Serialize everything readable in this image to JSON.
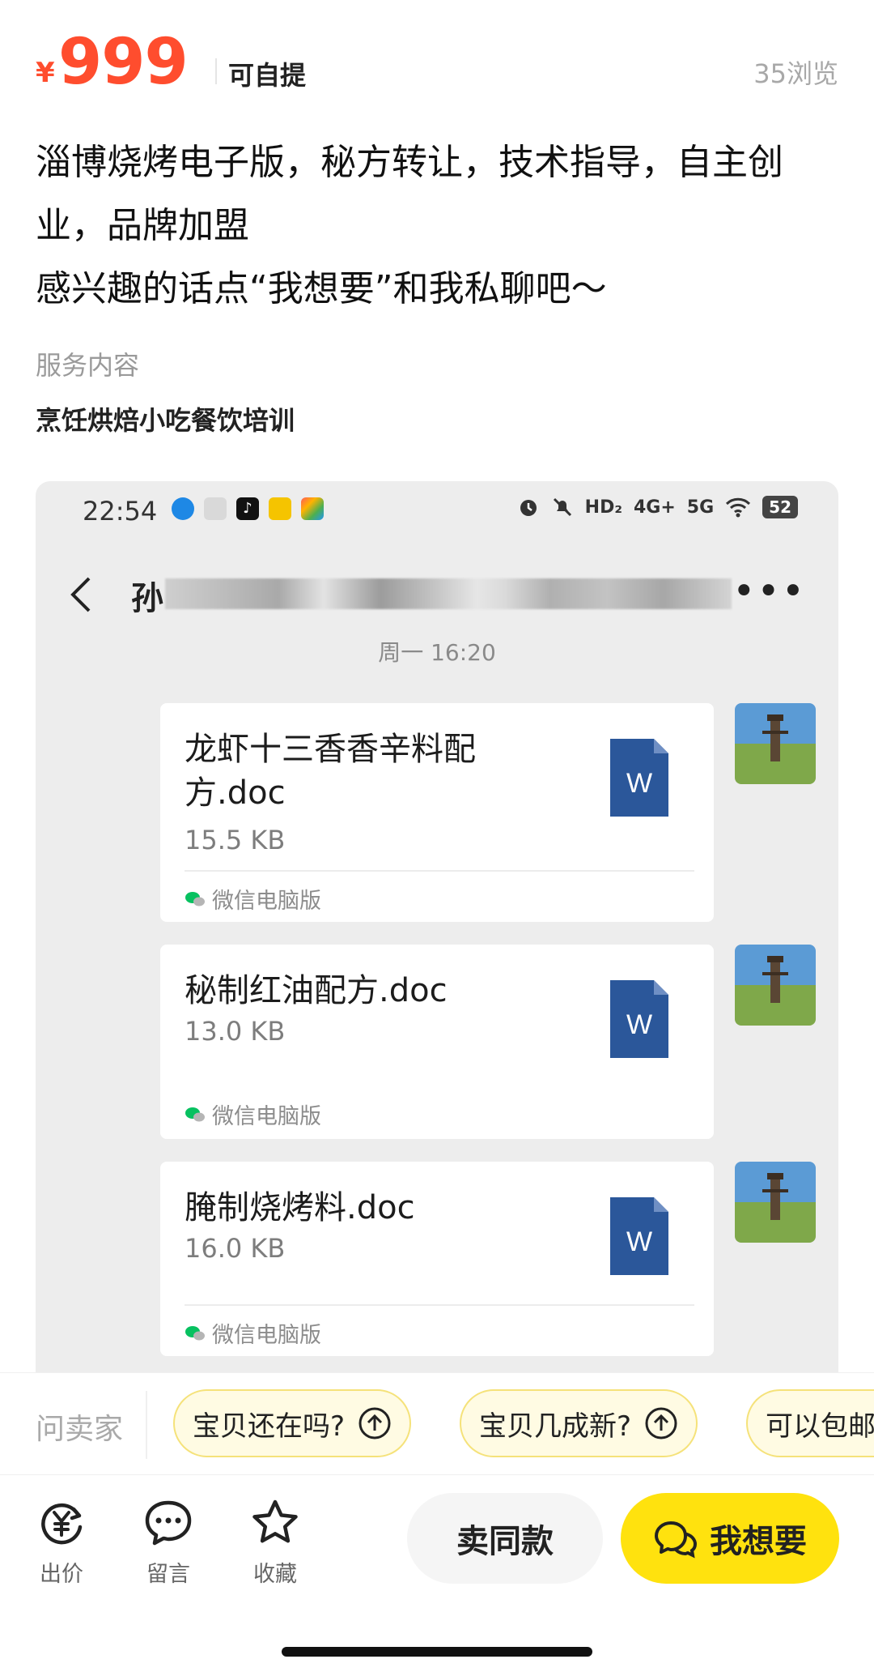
{
  "price": {
    "currency": "¥",
    "amount": "999",
    "pickup": "可自提",
    "views": "35浏览"
  },
  "description": {
    "lines": [
      "淄博烧烤电子版，秘方转让，技术指导，自主创",
      "业，品牌加盟",
      "感兴趣的话点“我想要”和我私聊吧～"
    ]
  },
  "service": {
    "label": "服务内容",
    "value": "烹饪烘焙小吃餐饮培训"
  },
  "screenshot": {
    "status_time": "22:54",
    "status_left_icons": [
      "circle-app-icon",
      "chat-bubble-icon",
      "tiktok-icon",
      "app-icon",
      "grid-app-icon"
    ],
    "status_right": [
      "alarm-icon",
      "mute-icon",
      "HD₂",
      "4G+",
      "5G",
      "wifi-icon"
    ],
    "battery": "52",
    "contact_initial": "孙",
    "chat_time": "周一 16:20",
    "files": [
      {
        "name": "龙虾十三香香辛料配方.doc",
        "size": "15.5 KB",
        "source": "微信电脑版"
      },
      {
        "name": "秘制红油配方.doc",
        "size": "13.0 KB",
        "source": "微信电脑版"
      },
      {
        "name": "腌制烧烤料.doc",
        "size": "16.0 KB",
        "source": "微信电脑版"
      }
    ],
    "word_letter": "W"
  },
  "ask": {
    "label": "问卖家",
    "chips": [
      "宝贝还在吗?",
      "宝贝几成新?",
      "可以包邮"
    ]
  },
  "bottom": {
    "tools": [
      {
        "label": "出价",
        "icon": "yuan-cycle-icon"
      },
      {
        "label": "留言",
        "icon": "comment-icon"
      },
      {
        "label": "收藏",
        "icon": "star-icon"
      }
    ],
    "sell_same": "卖同款",
    "want": "我想要"
  },
  "colors": {
    "price": "#ff4d2e",
    "want_button": "#ffe20e",
    "chip_bg": "#fffbe3",
    "word_blue": "#2b579a"
  }
}
